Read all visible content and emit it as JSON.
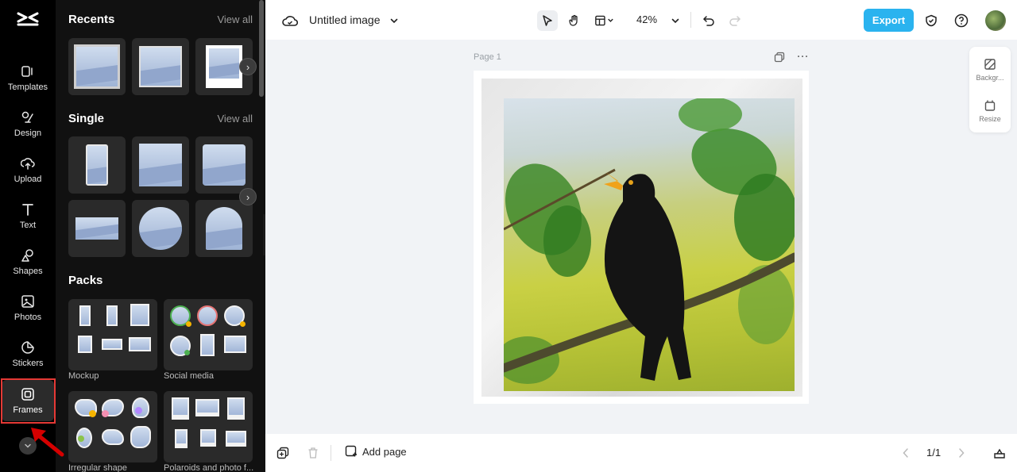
{
  "rail": {
    "items": [
      {
        "label": "Templates",
        "icon": "templates-icon"
      },
      {
        "label": "Design",
        "icon": "design-icon"
      },
      {
        "label": "Upload",
        "icon": "upload-icon"
      },
      {
        "label": "Text",
        "icon": "text-icon"
      },
      {
        "label": "Shapes",
        "icon": "shapes-icon"
      },
      {
        "label": "Photos",
        "icon": "photos-icon"
      },
      {
        "label": "Stickers",
        "icon": "stickers-icon"
      },
      {
        "label": "Frames",
        "icon": "frames-icon",
        "active": true
      }
    ]
  },
  "panel": {
    "recents": {
      "title": "Recents",
      "view_all": "View all"
    },
    "single": {
      "title": "Single",
      "view_all": "View all"
    },
    "packs": {
      "title": "Packs",
      "items": [
        {
          "label": "Mockup"
        },
        {
          "label": "Social media"
        },
        {
          "label": "Irregular shape"
        },
        {
          "label": "Polaroids and photo f..."
        }
      ]
    }
  },
  "topbar": {
    "title": "Untitled image",
    "zoom": "42%",
    "export_label": "Export"
  },
  "canvas": {
    "page_label": "Page 1",
    "side_tools": [
      {
        "label": "Backgr...",
        "icon": "background-icon"
      },
      {
        "label": "Resize",
        "icon": "resize-icon"
      }
    ]
  },
  "bottombar": {
    "add_page_label": "Add page",
    "pager": "1/1"
  },
  "colors": {
    "accent": "#2ab3ef",
    "rail_bg": "#000000",
    "panel_bg": "#111111",
    "highlight": "#e53935"
  }
}
